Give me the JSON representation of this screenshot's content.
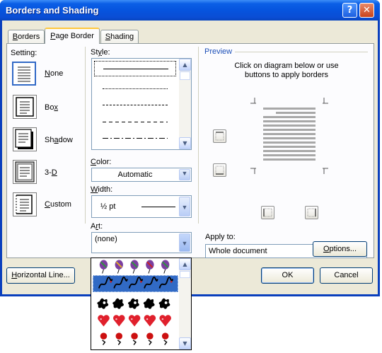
{
  "window": {
    "title": "Borders and Shading",
    "help": "?",
    "close": "✕"
  },
  "tabs": [
    {
      "label": "Borders",
      "hotkey": "B",
      "rest": "orders"
    },
    {
      "label": "Page Border",
      "pre": "",
      "hotkey": "P",
      "rest": "age Border"
    },
    {
      "label": "Shading",
      "hotkey": "S",
      "rest": "hading"
    }
  ],
  "setting": {
    "label": "Setting:",
    "items": [
      {
        "label": "None",
        "hotkey": "N",
        "rest": "one"
      },
      {
        "label": "Box",
        "pre": "Bo",
        "hotkey": "x",
        "rest": ""
      },
      {
        "label": "Shadow",
        "pre": "Sh",
        "hotkey": "a",
        "rest": "dow"
      },
      {
        "label": "3-D",
        "pre": "3-",
        "hotkey": "D",
        "rest": ""
      },
      {
        "label": "Custom",
        "hotkey": "C",
        "rest": "ustom"
      }
    ]
  },
  "style": {
    "label": "Style:",
    "pre": "St",
    "hotkey": "y",
    "rest": "le:"
  },
  "color": {
    "label": "Color:",
    "hotkey": "C",
    "rest": "olor:",
    "value": "Automatic"
  },
  "width": {
    "label": "Width:",
    "hotkey": "W",
    "rest": "idth:",
    "value": "½ pt"
  },
  "art": {
    "label": "Art:",
    "pre": "A",
    "hotkey": "r",
    "rest": "t:",
    "value": "(none)"
  },
  "preview": {
    "label": "Preview",
    "instruction_line1": "Click on diagram below or use",
    "instruction_line2": "buttons to apply borders"
  },
  "apply_to": {
    "label": "Apply to:",
    "hotkey": "L",
    "value": "Whole document"
  },
  "buttons": {
    "options": {
      "label": "Options...",
      "hotkey": "O",
      "rest": "ptions..."
    },
    "horizontal_line": {
      "label": "Horizontal Line...",
      "hotkey": "H",
      "rest": "orizontal Line..."
    },
    "ok": "OK",
    "cancel": "Cancel"
  },
  "art_dropdown": {
    "rows": [
      "balloons",
      "scribbles",
      "splats",
      "hearts",
      "apples"
    ],
    "selected_index": 1
  },
  "colors": {
    "accent": "#316ac5",
    "title_bar": "#0654de",
    "face": "#ece9d8",
    "hearts": "#e0202c",
    "apples": "#cc1010"
  }
}
